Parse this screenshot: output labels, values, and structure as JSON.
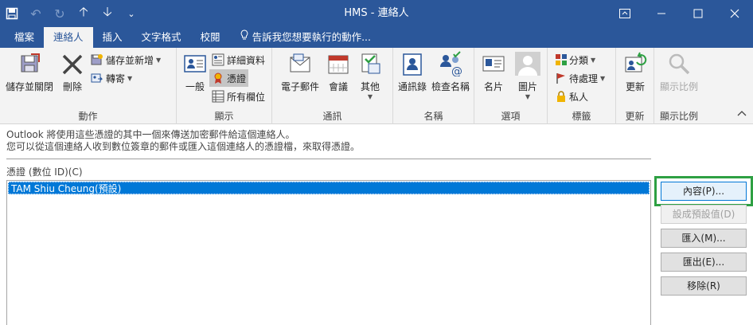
{
  "window": {
    "title": "HMS - 連絡人",
    "qat": [
      "save-icon",
      "undo-icon",
      "redo-icon",
      "up-arrow-icon",
      "down-arrow-icon",
      "customize-icon"
    ],
    "controls": [
      "ribbon-display-icon",
      "minimize-icon",
      "maximize-icon",
      "close-icon"
    ]
  },
  "tabs": [
    {
      "label": "檔案"
    },
    {
      "label": "連絡人",
      "active": true
    },
    {
      "label": "插入"
    },
    {
      "label": "文字格式"
    },
    {
      "label": "校閱"
    },
    {
      "label": "告訴我您想要執行的動作..."
    }
  ],
  "ribbon": {
    "groups": {
      "actions": {
        "label": "動作",
        "save_close": "儲存並關閉",
        "delete": "刪除",
        "save_new": "儲存並新增",
        "forward": "轉寄"
      },
      "show": {
        "label": "顯示",
        "general": "一般",
        "details": "詳細資料",
        "certificates": "憑證",
        "all_fields": "所有欄位"
      },
      "communicate": {
        "label": "通訊",
        "email": "電子郵件",
        "meeting": "會議",
        "more": "其他"
      },
      "names": {
        "label": "名稱",
        "address_book": "通訊錄",
        "check_names": "檢查名稱"
      },
      "options": {
        "label": "選項",
        "business_card": "名片",
        "picture": "圖片"
      },
      "tags": {
        "label": "標籤",
        "categorize": "分類",
        "follow_up": "待處理",
        "private": "私人"
      },
      "update": {
        "label": "更新",
        "update": "更新"
      },
      "zoom": {
        "label": "顯示比例",
        "zoom": "顯示比例"
      }
    }
  },
  "message": {
    "line1": "Outlook 將使用這些憑證的其中一個來傳送加密郵件給這個連絡人。",
    "line2": "您可以從這個連絡人收到數位簽章的郵件或匯入這個連絡人的憑證檔，來取得憑證。"
  },
  "certificates": {
    "label": "憑證 (數位 ID)(C)",
    "items": [
      "TAM Shiu Cheung(預設)"
    ]
  },
  "buttons": {
    "properties": "內容(P)...",
    "set_default": "設成預設值(D)",
    "import": "匯入(M)...",
    "export": "匯出(E)...",
    "remove": "移除(R)"
  },
  "colors": {
    "title_bar": "#2b579a",
    "selection": "#0078d7",
    "highlight_box": "#2ea043"
  }
}
